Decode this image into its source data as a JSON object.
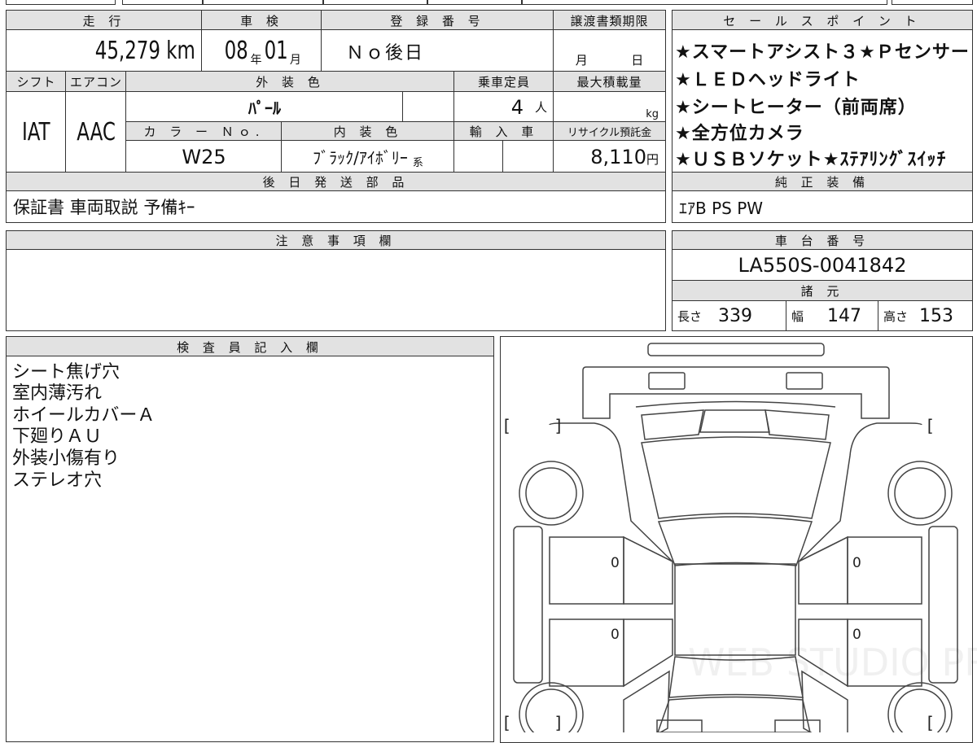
{
  "main_table": {
    "mileage_label": "走 行",
    "mileage_value": "45,279 km",
    "inspection_label": "車 検",
    "inspection_year": "08",
    "year_unit": "年",
    "inspection_month": "01",
    "month_unit": "月",
    "registration_label": "登 録 番 号",
    "registration_value": "Ｎｏ後日",
    "transfer_deadline_label": "譲渡書類期限",
    "transfer_month_unit": "月",
    "transfer_day_unit": "日",
    "shift_label": "シフト",
    "aircon_label": "エアコン",
    "exterior_color_label": "外 装 色",
    "capacity_label": "乗車定員",
    "max_load_label": "最大積載量",
    "shift_value": "IAT",
    "aircon_value": "AAC",
    "exterior_color_value": "ﾊﾟｰﾙ",
    "capacity_value": "4",
    "capacity_unit": "人",
    "max_load_unit": "kg",
    "color_no_label": "カ ラ ー Ｎｏ.",
    "interior_color_label": "内 装 色",
    "imported_label": "輸 入 車",
    "recycle_fee_label": "リサイクル預託金",
    "color_no_value": "W25",
    "interior_color_value": "ﾌﾞﾗｯｸ/ｱｲﾎﾞﾘｰ",
    "interior_color_suffix": "系",
    "recycle_fee_value": "8,110",
    "recycle_fee_unit": "円",
    "later_parts_label": "後 日 発 送 部 品",
    "later_parts_value": "保証書 車両取説 予備ｷｰ"
  },
  "sales_points": {
    "label": "セ ー ル ス ポ イ ン ト",
    "items": [
      "★スマートアシスト３★Ｐセンサー",
      "★ＬＥＤヘッドライト",
      "★シートヒーター（前両席）",
      "★全方位カメラ",
      "★ＵＳＢソケット★ｽﾃｱﾘﾝｸﾞｽｲｯﾁ"
    ],
    "genuine_equipment_label": "純 正 装 備",
    "genuine_equipment_value": "ｴｱB PS PW"
  },
  "notes": {
    "label": "注 意 事 項 欄",
    "value": ""
  },
  "chassis": {
    "label": "車 台 番 号",
    "value": "LA550S-0041842",
    "specs_label": "諸 元",
    "length_label": "長さ",
    "length_value": "339",
    "width_label": "幅",
    "width_value": "147",
    "height_label": "高さ",
    "height_value": "153"
  },
  "inspector": {
    "label": "検 査 員 記 入 欄",
    "lines": [
      "シート焦げ穴",
      "室内薄汚れ",
      "ホイールカバーＡ",
      "下廻りＡＵ",
      "外装小傷有り",
      "ステレオ穴"
    ]
  },
  "diagram": {
    "bracket": "[　　 ]",
    "zero_mark": "0",
    "watermark": "WEB STUDIO PRO"
  }
}
